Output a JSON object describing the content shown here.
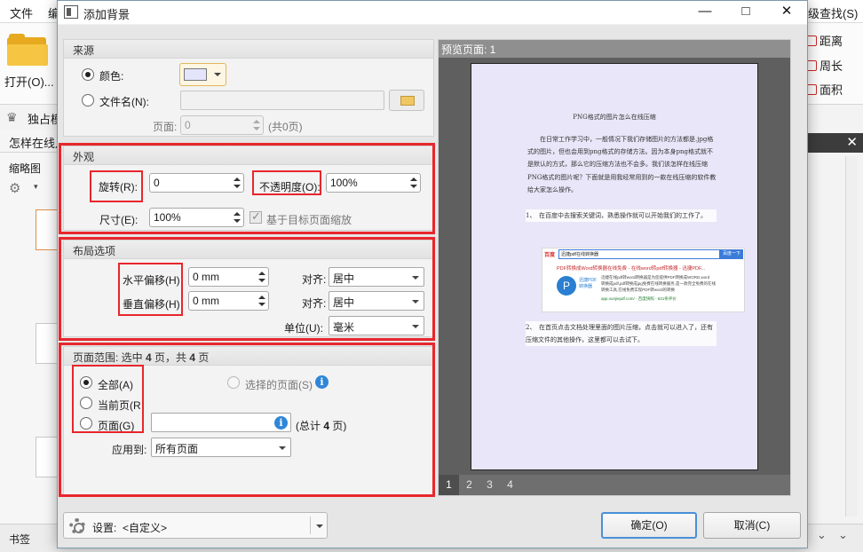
{
  "background_app": {
    "menu": [
      "文件",
      "编"
    ],
    "find_label": "级查找(S)",
    "open_label": "打开(O)...",
    "exclusive_label": "独占模",
    "doc_tab": "怎样在线月",
    "thumbnails_label": "缩略图",
    "bookmarks_label": "书签",
    "right_tools": [
      "距离",
      "周长",
      "面积"
    ]
  },
  "dialog": {
    "title": "添加背景",
    "title_buttons": {
      "minimize": "—",
      "maximize": "□",
      "close": "✕"
    },
    "source": {
      "header": "来源",
      "color_label": "颜色:",
      "color_value": "#e4e4fb",
      "filename_label": "文件名(N):",
      "filename_value": "",
      "page_label": "页面:",
      "page_value": "0",
      "page_total": "(共0页)"
    },
    "appearance": {
      "header": "外观",
      "rotation_label": "旋转(R):",
      "rotation_value": "0",
      "opacity_label": "不透明度(O):",
      "opacity_value": "100%",
      "size_label": "尺寸(E):",
      "size_value": "100%",
      "scale_checkbox_label": "基于目标页面缩放",
      "scale_checked": true
    },
    "layout": {
      "header": "布局选项",
      "h_offset_label": "水平偏移(H)",
      "h_offset_value": "0 mm",
      "v_offset_label": "垂直偏移(H)",
      "v_offset_value": "0 mm",
      "align_label": "对齐:",
      "h_align_value": "居中",
      "v_align_value": "居中",
      "unit_label": "单位(U):",
      "unit_value": "毫米"
    },
    "page_range": {
      "header_prefix": "页面范围: 选中 ",
      "selected_count": "4",
      "header_middle": " 页，共 ",
      "total_count": "4",
      "header_suffix": " 页",
      "all_label": "全部(A)",
      "current_label": "当前页(R",
      "pages_label": "页面(G)",
      "pages_value": "",
      "selected_pages_label": "选择的页面(S)",
      "total_prefix": "(总计 ",
      "total_value": "4",
      "total_suffix": " 页)",
      "apply_to_label": "应用到:",
      "apply_to_value": "所有页面"
    },
    "preview": {
      "header": "预览页面: 1",
      "pages": [
        "1",
        "2",
        "3",
        "4"
      ],
      "selected_page": "1",
      "doc_title": "PNG格式的图片怎么在线压缩",
      "doc_para1": "在日常工作学习中，一般情况下我们存储图片的方法都是.jpg格式的图片，但也会用到png格式的存储方法。因为本身png格式就不是默认的方式，那么它的压缩方法也不会多。我们该怎样在线压缩PNG格式的图片呢？下面就是用我经常用到的一款在线压缩的软件教给大家怎么操作。",
      "doc_step1": "1、　在百度中去搜索关键词，熟悉操作就可以开始我们的工作了。",
      "doc_step2": "2、　在首页点击文档处理里面的图片压缩，点击就可以进入了，还有压缩文件的其他操作，这里都可以去试下。",
      "shot_search": "迅捷pdf在线转换器",
      "shot_button": "百度一下",
      "shot_result_title": "PDF转换成Word转换器在线免费 - 在线word转pdf转换器 - 迅捷PDF...",
      "shot_brand": "迅捷PDF 转换器",
      "shot_line1": "迅捷在线pdf转word转换器是为您提供PDF转换成WORD,word",
      "shot_line2": "转换成pdf,pdf转换成jpg免费在线转换服务,是一款完全免费的在线",
      "shot_line3": "转换工具,在线免费实现PDF转word的转换",
      "shot_url": "app.xunjiepdf.com/ - 百度快照 - 621条评价"
    },
    "settings_label": "设置:",
    "settings_value": "<自定义>",
    "ok_label": "确定(O)",
    "cancel_label": "取消(C)"
  }
}
